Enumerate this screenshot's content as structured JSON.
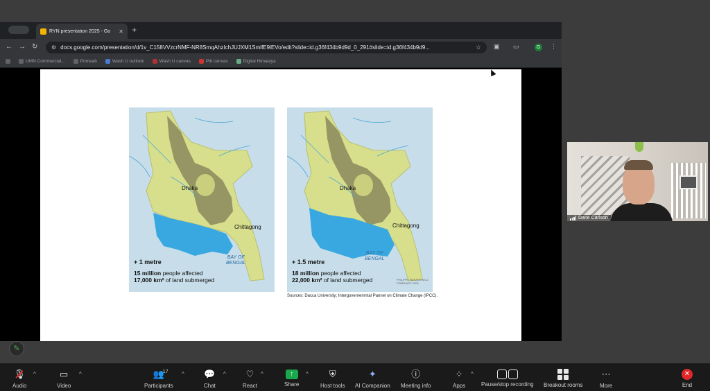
{
  "browser": {
    "tab_title": "RYN presentation 2025 - Go",
    "url": "docs.google.com/presentation/d/1v_C158VVzcrNMF-NR8SmqAhzIchJUJXM1SmlfE9lEVo/edit?slide=id.g36f434b9d9d_0_291#slide=id.g36f434b9d9...",
    "bookmarks": [
      {
        "label": "UMN Commercial..."
      },
      {
        "label": "Primeab"
      },
      {
        "label": "Wash U outlook"
      },
      {
        "label": "Wash U canvas"
      },
      {
        "label": "Pitt canvas"
      },
      {
        "label": "Digital Himalaya"
      }
    ]
  },
  "slide": {
    "maps": [
      {
        "dhaka": "Dhaka",
        "chittagong": "Chittagong",
        "sea_line1": "BAY OF",
        "sea_line2": "BENGAL",
        "rise": "+ 1 metre",
        "people_bold": "15 million",
        "people_rest": " people affected",
        "land_bold": "17,000 km²",
        "land_rest": " of land submerged"
      },
      {
        "dhaka": "Dhaka",
        "chittagong": "Chittagong",
        "sea_line1": "BAY OF",
        "sea_line2": "BENGAL",
        "rise": "+ 1.5 metre",
        "people_bold": "18 million",
        "people_rest": " people affected",
        "land_bold": "22,000 km²",
        "land_rest": " of land submerged",
        "credit": "PHILIPPE REKACEWICZ FEBRUARY 2008"
      }
    ],
    "sources": "Sources: Dacca University; Intergovernemntal Pannel on Climate Change (IPCC)."
  },
  "video": {
    "participant_name": "Dane Carlson"
  },
  "zoom_toolbar": {
    "audio": "Audio",
    "video": "Video",
    "participants": "Participants",
    "participants_count": "17",
    "chat": "Chat",
    "react": "React",
    "share": "Share",
    "host_tools": "Host tools",
    "ai_companion": "AI Companion",
    "meeting_info": "Meeting info",
    "apps": "Apps",
    "pause_recording": "Pause/stop recording",
    "breakout_rooms": "Breakout rooms",
    "more": "More",
    "end": "End"
  },
  "colors": {
    "share_green": "#1aa84e",
    "end_red": "#e02828",
    "map_land": "#d7df8c",
    "map_lowland": "#8f8d5f",
    "map_flood": "#3aa8e0",
    "map_sea": "#c7dde9"
  }
}
